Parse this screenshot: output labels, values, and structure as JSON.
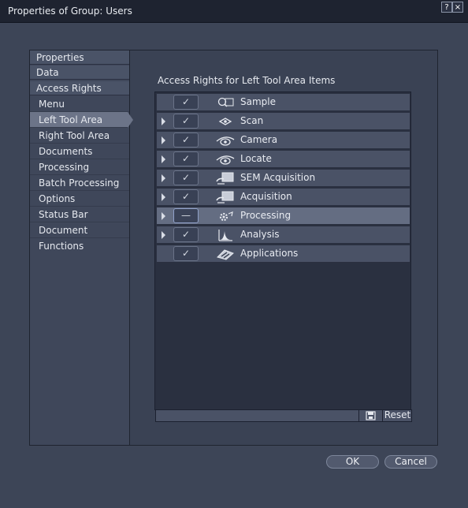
{
  "window": {
    "title": "Properties of Group: Users",
    "help_label": "?",
    "close_label": "×"
  },
  "sidebar": {
    "properties_header": "Properties",
    "data_header": "Data",
    "access_header": "Access Rights",
    "items": [
      {
        "label": "Menu"
      },
      {
        "label": "Left Tool Area",
        "selected": true
      },
      {
        "label": "Right Tool Area"
      },
      {
        "label": "Documents"
      },
      {
        "label": "Processing"
      },
      {
        "label": "Batch Processing"
      },
      {
        "label": "Options"
      },
      {
        "label": "Status Bar"
      },
      {
        "label": "Document Functions"
      }
    ]
  },
  "main": {
    "section_title": "Access Rights for Left Tool Area Items",
    "rows": [
      {
        "label": "Sample",
        "icon": "sample-icon",
        "state": "checked",
        "expandable": false
      },
      {
        "label": "Scan",
        "icon": "scan-icon",
        "state": "checked",
        "expandable": true
      },
      {
        "label": "Camera",
        "icon": "camera-icon",
        "state": "checked",
        "expandable": true
      },
      {
        "label": "Locate",
        "icon": "locate-icon",
        "state": "checked",
        "expandable": true
      },
      {
        "label": "SEM Acquisition",
        "icon": "sem-acquisition-icon",
        "state": "checked",
        "expandable": true
      },
      {
        "label": "Acquisition",
        "icon": "acquisition-icon",
        "state": "checked",
        "expandable": true
      },
      {
        "label": "Processing",
        "icon": "processing-icon",
        "state": "partial",
        "expandable": true,
        "selected": true
      },
      {
        "label": "Analysis",
        "icon": "analysis-icon",
        "state": "checked",
        "expandable": true
      },
      {
        "label": "Applications",
        "icon": "applications-icon",
        "state": "checked",
        "expandable": false
      }
    ],
    "check_glyph": "✓",
    "partial_glyph": "—",
    "reset_label": "Reset"
  },
  "footer": {
    "ok_label": "OK",
    "cancel_label": "Cancel"
  }
}
